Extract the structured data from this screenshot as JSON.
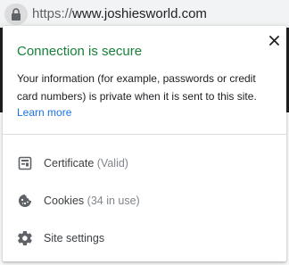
{
  "address_bar": {
    "scheme": "https://",
    "host": "www.joshiesworld.com"
  },
  "popup": {
    "title": "Connection is secure",
    "description": "Your information (for example, passwords or credit card numbers) is private when it is sent to this site.",
    "learn_more": "Learn more",
    "items": [
      {
        "label": "Certificate",
        "detail": "(Valid)",
        "icon": "certificate-icon"
      },
      {
        "label": "Cookies",
        "detail": "(34 in use)",
        "icon": "cookie-icon"
      },
      {
        "label": "Site settings",
        "detail": "",
        "icon": "gear-icon"
      }
    ]
  },
  "colors": {
    "secure_green": "#188038",
    "link_blue": "#1a73e8",
    "icon_gray": "#5f6368"
  }
}
